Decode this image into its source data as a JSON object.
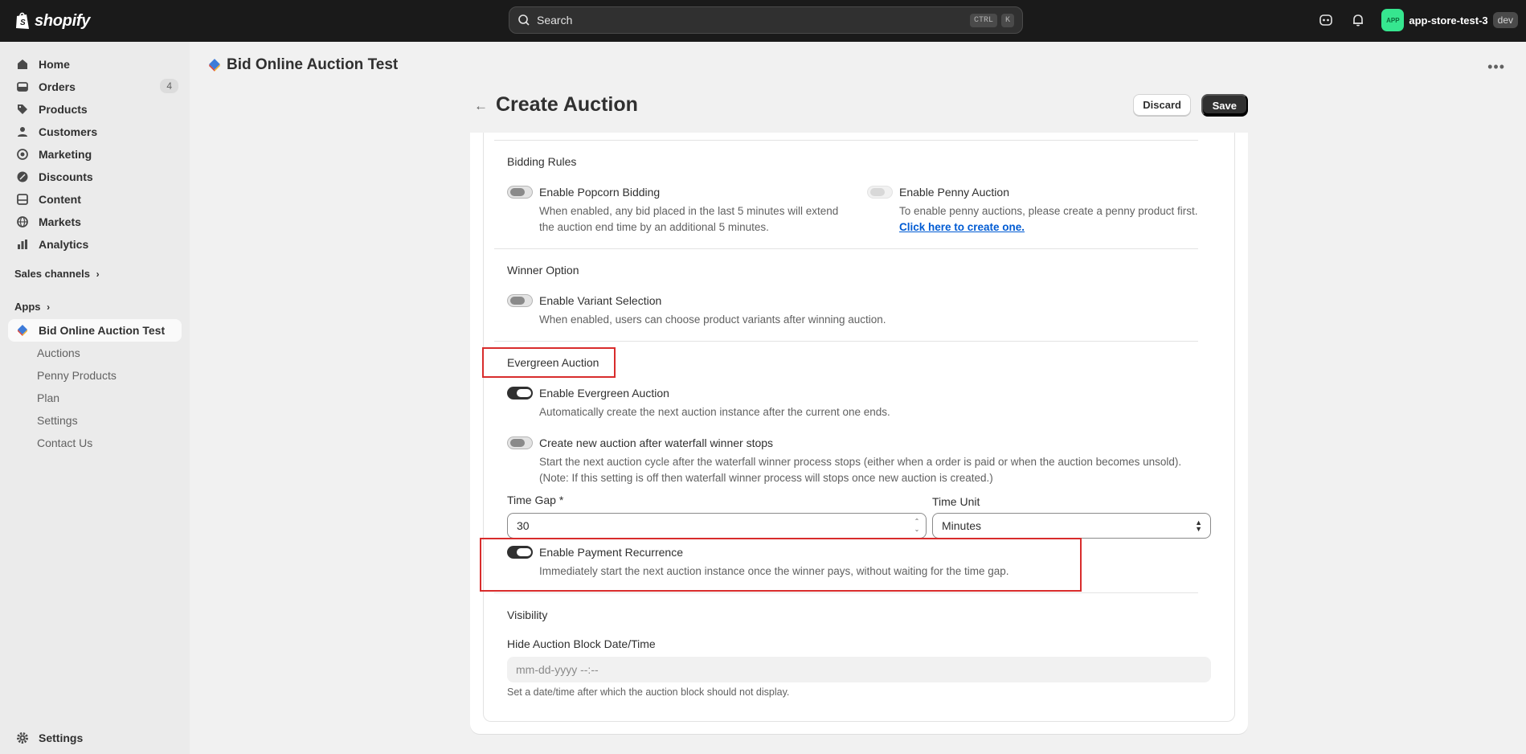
{
  "topbar": {
    "logo_text": "shopify",
    "search_placeholder": "Search",
    "kbd_1": "CTRL",
    "kbd_2": "K",
    "store_avatar_text": "APP",
    "store_name": "app-store-test-3",
    "store_badge": "dev"
  },
  "sidebar": {
    "items": [
      {
        "label": "Home",
        "icon": "home-icon"
      },
      {
        "label": "Orders",
        "icon": "orders-icon",
        "count": "4"
      },
      {
        "label": "Products",
        "icon": "tag-icon"
      },
      {
        "label": "Customers",
        "icon": "person-icon"
      },
      {
        "label": "Marketing",
        "icon": "target-icon"
      },
      {
        "label": "Discounts",
        "icon": "discount-icon"
      },
      {
        "label": "Content",
        "icon": "content-icon"
      },
      {
        "label": "Markets",
        "icon": "globe-icon"
      },
      {
        "label": "Analytics",
        "icon": "chart-icon"
      }
    ],
    "sales_channels": "Sales channels",
    "apps": "Apps",
    "app_name": "Bid Online Auction Test",
    "app_subitems": [
      "Auctions",
      "Penny Products",
      "Plan",
      "Settings",
      "Contact Us"
    ],
    "settings": "Settings"
  },
  "app_header": {
    "title": "Bid Online Auction Test"
  },
  "page": {
    "title": "Create Auction",
    "discard": "Discard",
    "save": "Save"
  },
  "form": {
    "bidding_rules": {
      "title": "Bidding Rules",
      "popcorn_label": "Enable Popcorn Bidding",
      "popcorn_help_1": "When enabled, any bid placed in the last 5 minutes will extend",
      "popcorn_help_2": "the auction end time by an additional 5 minutes.",
      "popcorn_enabled": false,
      "penny_label": "Enable Penny Auction",
      "penny_help": "To enable penny auctions, please create a penny product first.",
      "penny_link": "Click here to create one."
    },
    "winner_option": {
      "title": "Winner Option",
      "variant_label": "Enable Variant Selection",
      "variant_help": "When enabled, users can choose product variants after winning auction.",
      "variant_enabled": false
    },
    "evergreen": {
      "title": "Evergreen Auction",
      "enable_label": "Enable Evergreen Auction",
      "enable_help": "Automatically create the next auction instance after the current one ends.",
      "enable_enabled": true,
      "waterfall_label": "Create new auction after waterfall winner stops",
      "waterfall_help_1": "Start the next auction cycle after the waterfall winner process stops (either when a order is paid or when the auction becomes unsold).",
      "waterfall_help_2": "(Note: If this setting is off then waterfall winner process will stops once new auction is created.)",
      "waterfall_enabled": false,
      "time_gap_label": "Time Gap *",
      "time_gap_value": "30",
      "time_unit_label": "Time Unit",
      "time_unit_value": "Minutes",
      "payment_label": "Enable Payment Recurrence",
      "payment_help": "Immediately start the next auction instance once the winner pays, without waiting for the time gap.",
      "payment_enabled": true
    },
    "visibility": {
      "title": "Visibility",
      "hide_label": "Hide Auction Block Date/Time",
      "hide_placeholder": "mm-dd-yyyy --:--",
      "hide_help": "Set a date/time after which the auction block should not display."
    }
  },
  "colors": {
    "topbar_bg": "#1a1a1a",
    "highlight": "#d82c2c",
    "link": "#005bd3",
    "avatar": "#36e68f"
  }
}
